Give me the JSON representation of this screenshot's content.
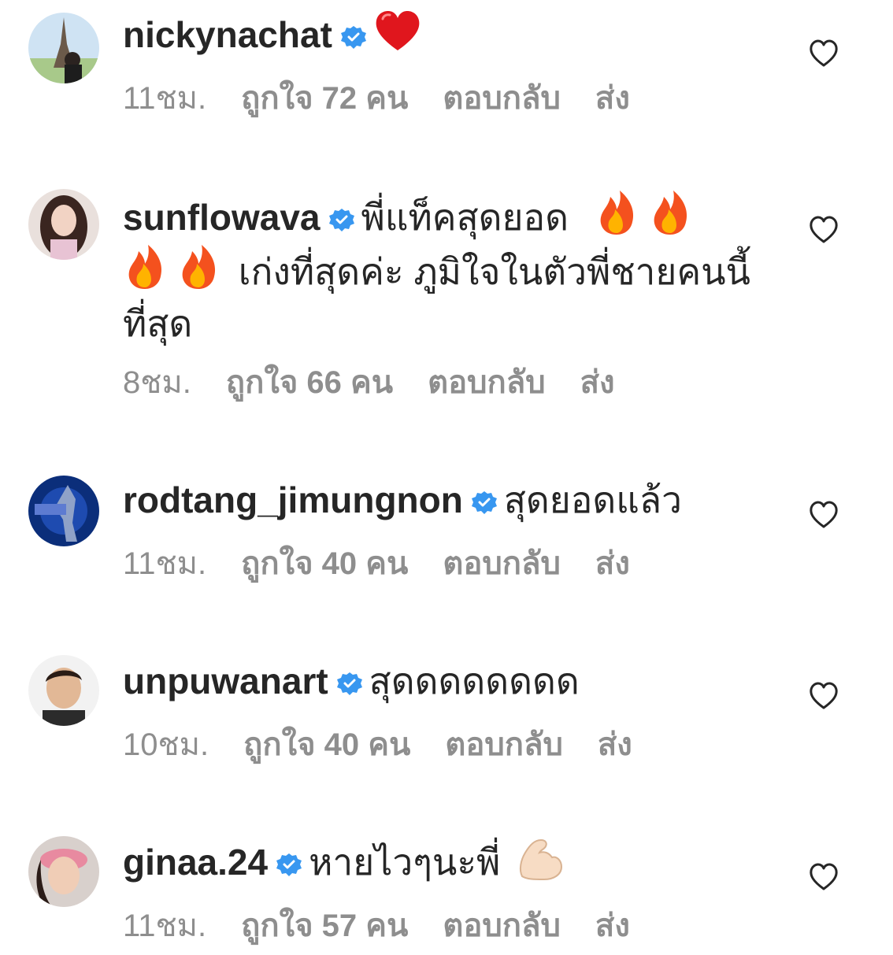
{
  "colors": {
    "text": "#262626",
    "meta": "#8e8e8e",
    "verified": "#3897f0"
  },
  "comments": [
    {
      "username": "nickynachat",
      "text": "",
      "emoji": [
        "red-heart"
      ],
      "time": "11ชม.",
      "likes": "ถูกใจ 72 คน",
      "reply": "ตอบกลับ",
      "send": "ส่ง"
    },
    {
      "username": "sunflowava",
      "text_a": "พี่แท็คสุดยอด",
      "text_b": "เก่งที่สุดค่ะ ภูมิใจในตัวพี่ชายคนนี้ที่สุด",
      "emoji": [
        "fire",
        "fire",
        "fire",
        "fire"
      ],
      "time": "8ชม.",
      "likes": "ถูกใจ 66 คน",
      "reply": "ตอบกลับ",
      "send": "ส่ง"
    },
    {
      "username": "rodtang_jimungnon",
      "text": "สุดยอดแล้ว",
      "time": "11ชม.",
      "likes": "ถูกใจ 40 คน",
      "reply": "ตอบกลับ",
      "send": "ส่ง"
    },
    {
      "username": "unpuwanart",
      "text": "สุดดดดดดดด",
      "time": "10ชม.",
      "likes": "ถูกใจ 40 คน",
      "reply": "ตอบกลับ",
      "send": "ส่ง"
    },
    {
      "username": "ginaa.24",
      "text": "หายไวๆนะพี่",
      "emoji": [
        "flexed-biceps"
      ],
      "time": "11ชม.",
      "likes": "ถูกใจ 57 คน",
      "reply": "ตอบกลับ",
      "send": "ส่ง"
    }
  ]
}
